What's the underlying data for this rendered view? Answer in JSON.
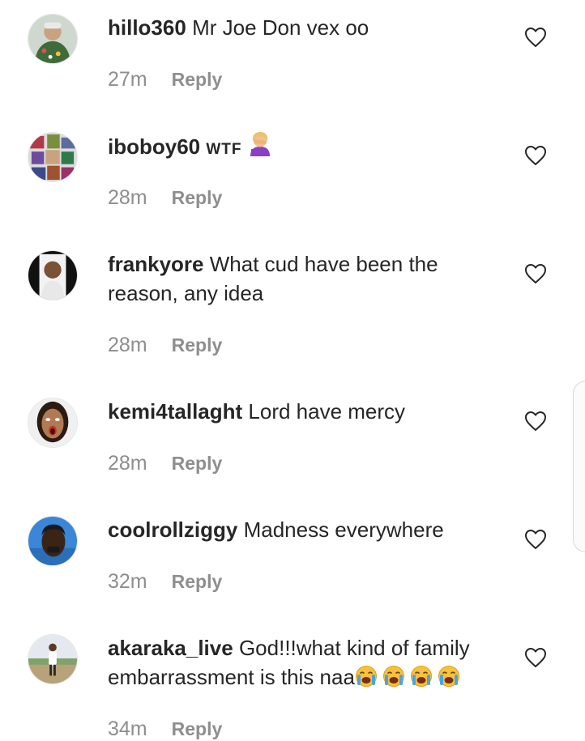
{
  "comments": [
    {
      "username": "hillo360",
      "text": "Mr Joe Don vex oo",
      "time": "27m",
      "reply_label": "Reply",
      "avatar_icon": "profile-photo-icon",
      "like_icon": "heart-outline-icon"
    },
    {
      "username": "iboboy60",
      "text": "WTF",
      "emoji": "woman-facepalming-emoji",
      "time": "28m",
      "reply_label": "Reply",
      "avatar_icon": "profile-photo-icon",
      "like_icon": "heart-outline-icon"
    },
    {
      "username": "frankyore",
      "text": "What cud have been the reason, any idea",
      "time": "28m",
      "reply_label": "Reply",
      "avatar_icon": "profile-photo-icon",
      "like_icon": "heart-outline-icon"
    },
    {
      "username": "kemi4tallaght",
      "text": "Lord have mercy",
      "time": "28m",
      "reply_label": "Reply",
      "avatar_icon": "profile-photo-icon",
      "like_icon": "heart-outline-icon"
    },
    {
      "username": "coolrollziggy",
      "text": "Madness everywhere",
      "time": "32m",
      "reply_label": "Reply",
      "avatar_icon": "profile-photo-icon",
      "like_icon": "heart-outline-icon"
    },
    {
      "username": "akaraka_live",
      "text": "God!!!what kind of family embarrassment is this naa",
      "emoji": "loudly-crying-face-emoji",
      "emoji_count": 4,
      "time": "34m",
      "reply_label": "Reply",
      "avatar_icon": "profile-photo-icon",
      "like_icon": "heart-outline-icon"
    }
  ],
  "colors": {
    "text": "#262626",
    "secondary": "#8e8e8e",
    "background": "#ffffff"
  }
}
